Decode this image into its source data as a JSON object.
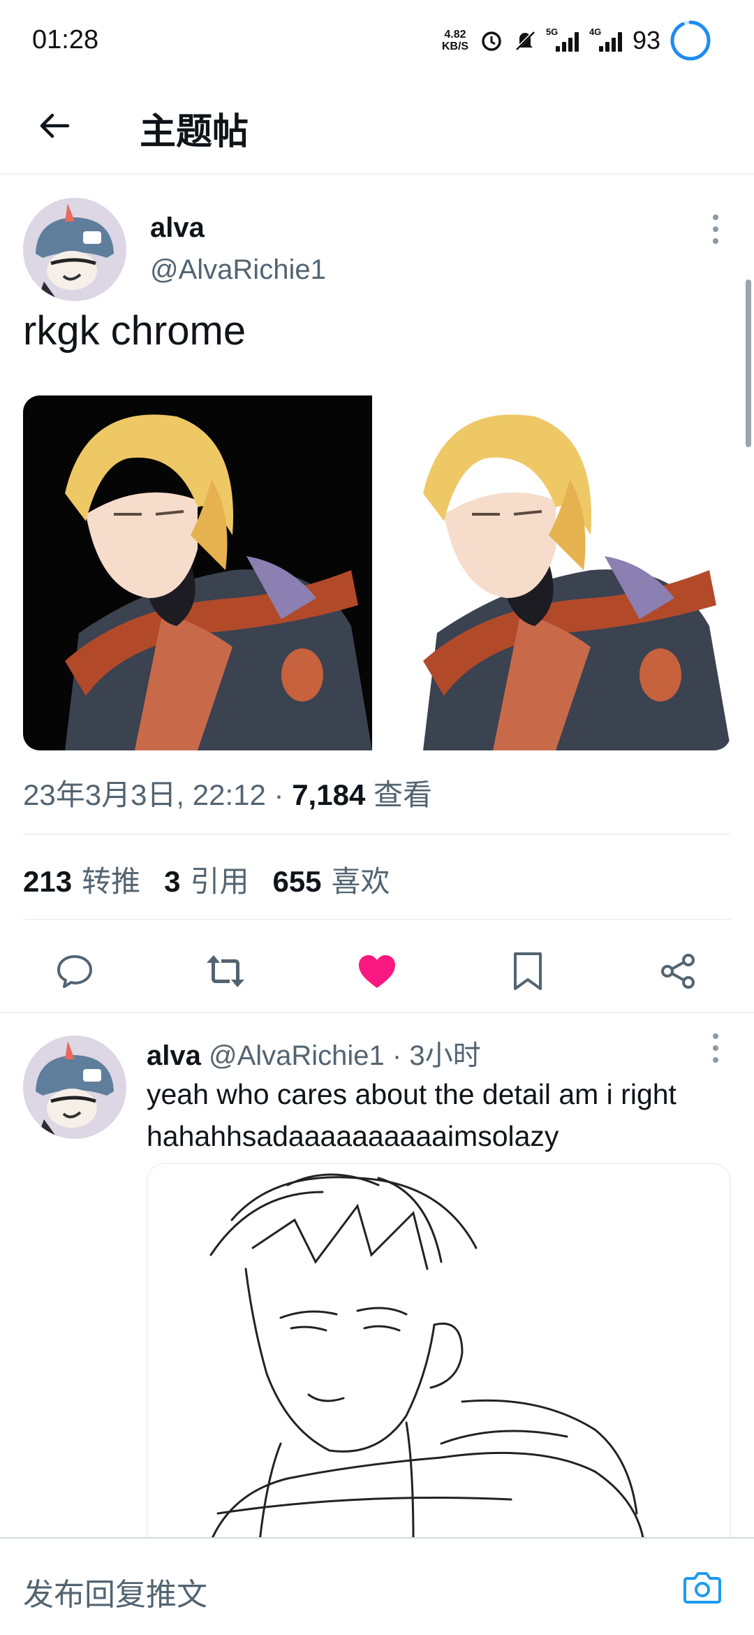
{
  "status_bar": {
    "time": "01:28",
    "net_speed_value": "4.82",
    "net_speed_unit": "KB/S",
    "sim1_tag": "5G",
    "sim2_tag": "4G",
    "battery": "93",
    "battery_level": 0.93
  },
  "header": {
    "title": "主题帖",
    "back_icon": "arrow-left-icon"
  },
  "main_tweet": {
    "author_name": "alva",
    "author_handle": "@AlvaRichie1",
    "text": "rkgk chrome",
    "media": [
      "illustration-dark-background",
      "illustration-white-background"
    ],
    "timestamp": "23年3月3日, 22:12 · ",
    "views_count": "7,184",
    "views_label": " 查看",
    "stats": {
      "retweets_count": "213",
      "retweets_label": "转推",
      "quotes_count": "3",
      "quotes_label": "引用",
      "likes_count": "655",
      "likes_label": "喜欢"
    },
    "liked": true,
    "like_color": "#f91880"
  },
  "actions": {
    "reply_icon": "comment-icon",
    "retweet_icon": "retweet-icon",
    "like_icon": "heart-icon",
    "bookmark_icon": "bookmark-icon",
    "share_icon": "share-icon"
  },
  "reply_tweet": {
    "author_name": "alva",
    "author_handle": "@AlvaRichie1",
    "time": " · 3小时",
    "text_line1": "yeah who cares about the detail am i right",
    "text_line2": "hahahhsadaaaaaaaaaaimsolazy",
    "media": "sketch-line-art"
  },
  "compose": {
    "placeholder": "发布回复推文",
    "camera_icon": "camera-icon",
    "accent_color": "#1d9bf0"
  }
}
